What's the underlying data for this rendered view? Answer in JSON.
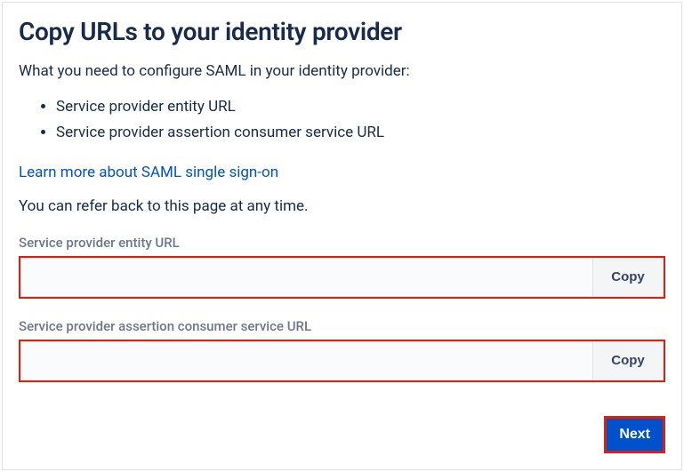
{
  "heading": "Copy URLs to your identity provider",
  "intro": "What you need to configure SAML in your identity provider:",
  "bullets": [
    "Service provider entity URL",
    "Service provider assertion consumer service URL"
  ],
  "link_text": "Learn more about SAML single sign-on",
  "refer_text": "You can refer back to this page at any time.",
  "fields": {
    "entity": {
      "label": "Service provider entity URL",
      "value": "",
      "copy_label": "Copy"
    },
    "acs": {
      "label": "Service provider assertion consumer service URL",
      "value": "",
      "copy_label": "Copy"
    }
  },
  "next_label": "Next"
}
